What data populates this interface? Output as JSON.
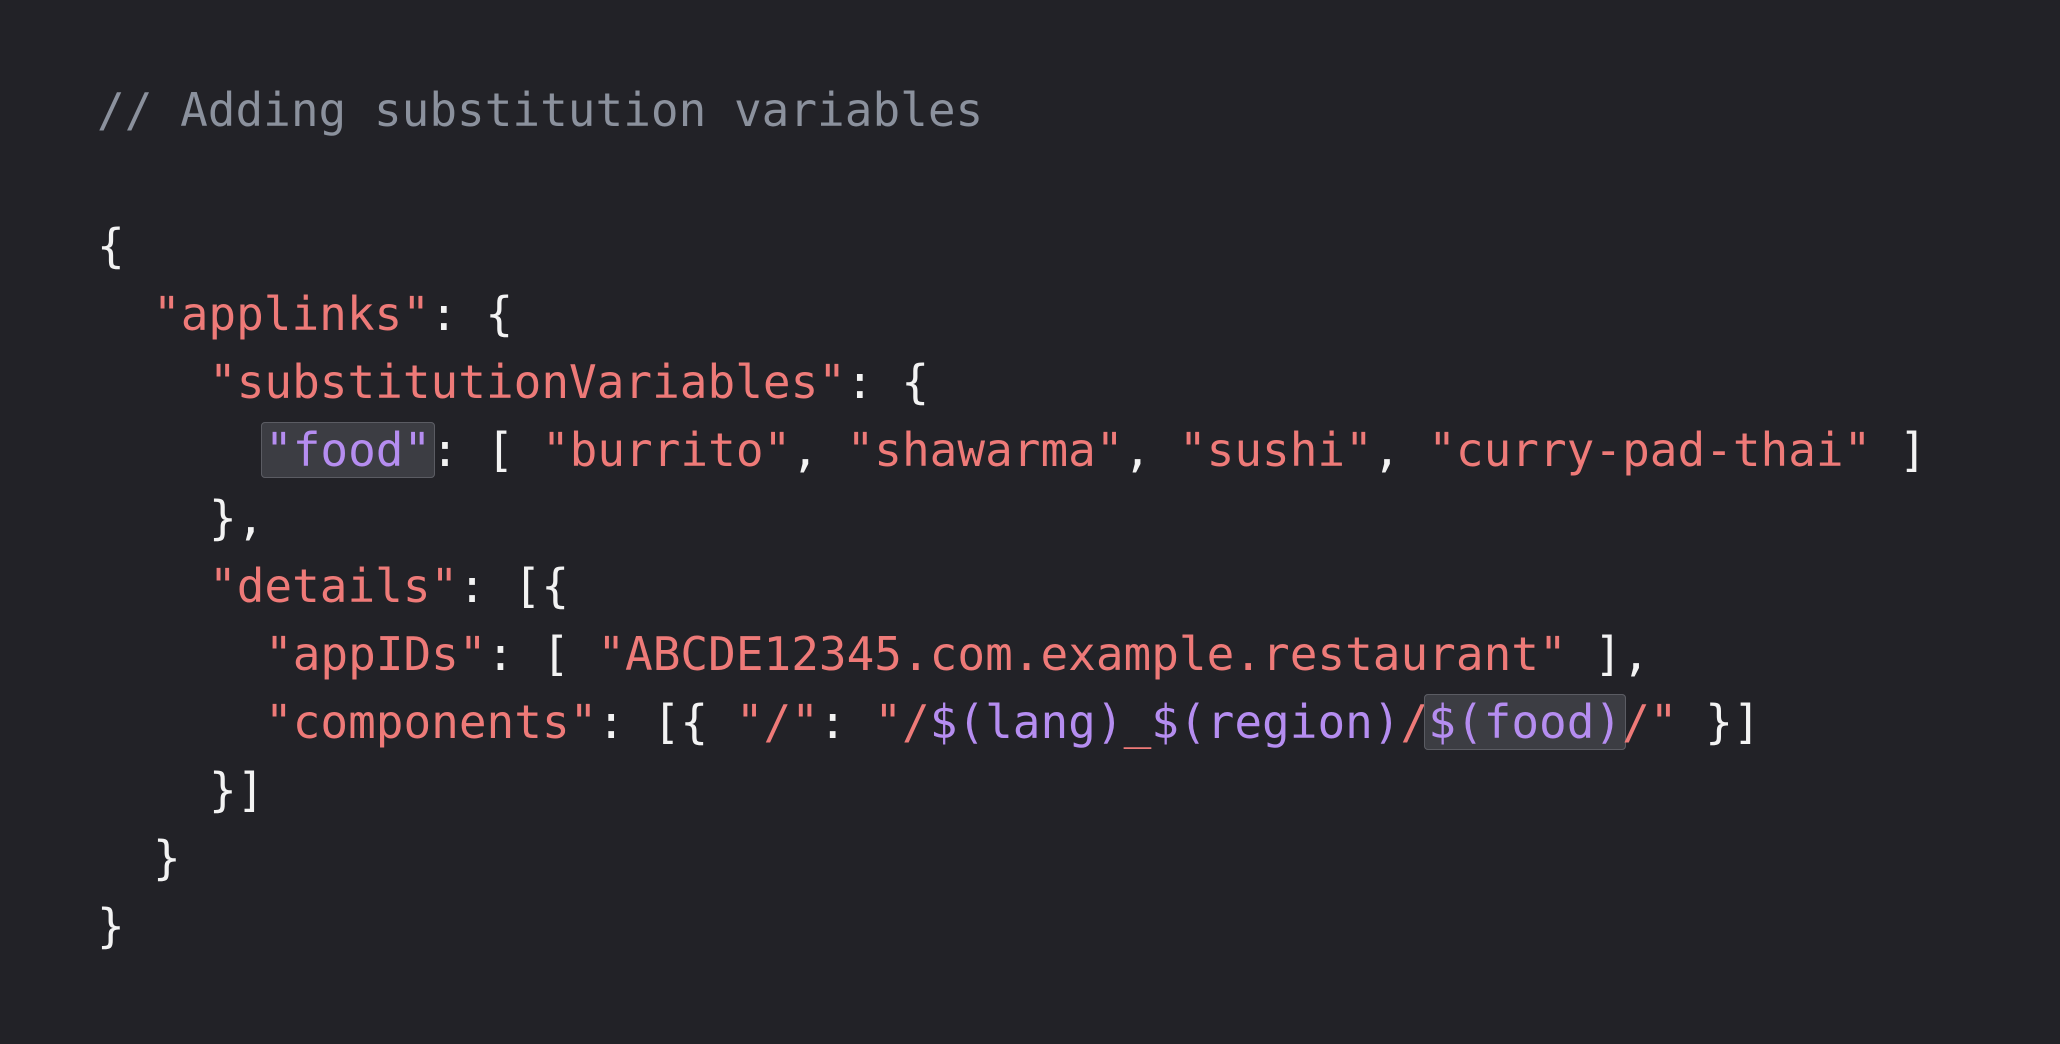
{
  "code": {
    "comment": "// Adding substitution variables",
    "line_open_brace": "{",
    "applinks_key": "\"applinks\"",
    "applinks_punct": ": {",
    "subst_key": "\"substitutionVariables\"",
    "subst_punct": ": {",
    "food_key": "\"food\"",
    "food_open": ": [ ",
    "food_values": [
      "\"burrito\"",
      "\"shawarma\"",
      "\"sushi\"",
      "\"curry-pad-thai\""
    ],
    "sep": ", ",
    "food_close": " ]",
    "subst_close": "},",
    "details_key": "\"details\"",
    "details_punct": ": [{",
    "appids_key": "\"appIDs\"",
    "appids_open": ": [ ",
    "appids_value": "\"ABCDE12345.com.example.restaurant\"",
    "appids_close": " ],",
    "components_key": "\"components\"",
    "components_open": ": [{ ",
    "path_key": "\"/\"",
    "path_colon": ": ",
    "path_prefix": "\"/",
    "var_lang": "$(lang)",
    "underscore": "_",
    "var_region": "$(region)",
    "slash": "/",
    "var_food": "$(food)",
    "path_suffix": "/\"",
    "components_close": " }]",
    "details_close": "}]",
    "applinks_close": "}",
    "root_close": "}"
  }
}
